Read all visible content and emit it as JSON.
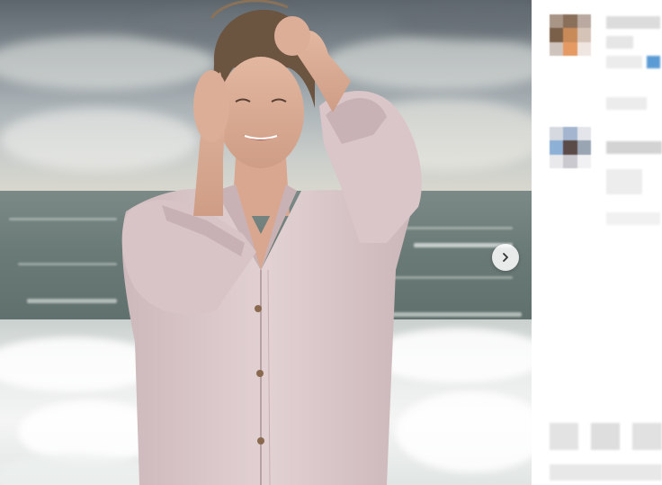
{
  "photo": {
    "alt": "",
    "carousel": {
      "next_icon": "chevron-right-icon"
    }
  },
  "sidebar": {
    "blurred": true
  },
  "colors": {
    "shirt": "#d9c6c8",
    "sky": "#8b959a",
    "sea": "#6a7a76",
    "foam": "#f1f3f2"
  }
}
